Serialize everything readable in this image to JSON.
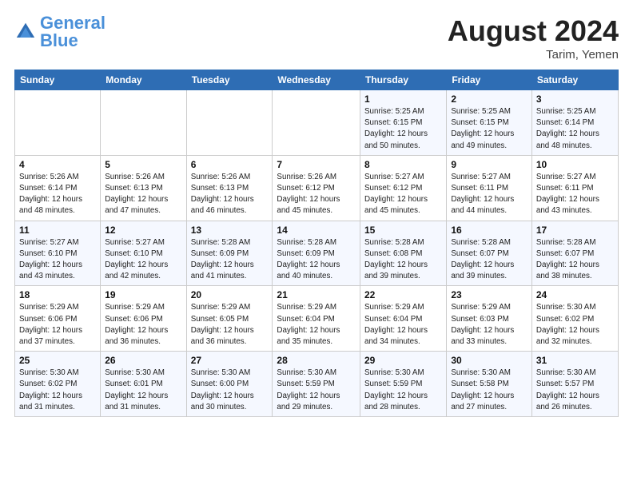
{
  "header": {
    "logo_line1": "General",
    "logo_line2": "Blue",
    "month_title": "August 2024",
    "location": "Tarim, Yemen"
  },
  "weekdays": [
    "Sunday",
    "Monday",
    "Tuesday",
    "Wednesday",
    "Thursday",
    "Friday",
    "Saturday"
  ],
  "weeks": [
    [
      {
        "day": "",
        "info": ""
      },
      {
        "day": "",
        "info": ""
      },
      {
        "day": "",
        "info": ""
      },
      {
        "day": "",
        "info": ""
      },
      {
        "day": "1",
        "info": "Sunrise: 5:25 AM\nSunset: 6:15 PM\nDaylight: 12 hours\nand 50 minutes."
      },
      {
        "day": "2",
        "info": "Sunrise: 5:25 AM\nSunset: 6:15 PM\nDaylight: 12 hours\nand 49 minutes."
      },
      {
        "day": "3",
        "info": "Sunrise: 5:25 AM\nSunset: 6:14 PM\nDaylight: 12 hours\nand 48 minutes."
      }
    ],
    [
      {
        "day": "4",
        "info": "Sunrise: 5:26 AM\nSunset: 6:14 PM\nDaylight: 12 hours\nand 48 minutes."
      },
      {
        "day": "5",
        "info": "Sunrise: 5:26 AM\nSunset: 6:13 PM\nDaylight: 12 hours\nand 47 minutes."
      },
      {
        "day": "6",
        "info": "Sunrise: 5:26 AM\nSunset: 6:13 PM\nDaylight: 12 hours\nand 46 minutes."
      },
      {
        "day": "7",
        "info": "Sunrise: 5:26 AM\nSunset: 6:12 PM\nDaylight: 12 hours\nand 45 minutes."
      },
      {
        "day": "8",
        "info": "Sunrise: 5:27 AM\nSunset: 6:12 PM\nDaylight: 12 hours\nand 45 minutes."
      },
      {
        "day": "9",
        "info": "Sunrise: 5:27 AM\nSunset: 6:11 PM\nDaylight: 12 hours\nand 44 minutes."
      },
      {
        "day": "10",
        "info": "Sunrise: 5:27 AM\nSunset: 6:11 PM\nDaylight: 12 hours\nand 43 minutes."
      }
    ],
    [
      {
        "day": "11",
        "info": "Sunrise: 5:27 AM\nSunset: 6:10 PM\nDaylight: 12 hours\nand 43 minutes."
      },
      {
        "day": "12",
        "info": "Sunrise: 5:27 AM\nSunset: 6:10 PM\nDaylight: 12 hours\nand 42 minutes."
      },
      {
        "day": "13",
        "info": "Sunrise: 5:28 AM\nSunset: 6:09 PM\nDaylight: 12 hours\nand 41 minutes."
      },
      {
        "day": "14",
        "info": "Sunrise: 5:28 AM\nSunset: 6:09 PM\nDaylight: 12 hours\nand 40 minutes."
      },
      {
        "day": "15",
        "info": "Sunrise: 5:28 AM\nSunset: 6:08 PM\nDaylight: 12 hours\nand 39 minutes."
      },
      {
        "day": "16",
        "info": "Sunrise: 5:28 AM\nSunset: 6:07 PM\nDaylight: 12 hours\nand 39 minutes."
      },
      {
        "day": "17",
        "info": "Sunrise: 5:28 AM\nSunset: 6:07 PM\nDaylight: 12 hours\nand 38 minutes."
      }
    ],
    [
      {
        "day": "18",
        "info": "Sunrise: 5:29 AM\nSunset: 6:06 PM\nDaylight: 12 hours\nand 37 minutes."
      },
      {
        "day": "19",
        "info": "Sunrise: 5:29 AM\nSunset: 6:06 PM\nDaylight: 12 hours\nand 36 minutes."
      },
      {
        "day": "20",
        "info": "Sunrise: 5:29 AM\nSunset: 6:05 PM\nDaylight: 12 hours\nand 36 minutes."
      },
      {
        "day": "21",
        "info": "Sunrise: 5:29 AM\nSunset: 6:04 PM\nDaylight: 12 hours\nand 35 minutes."
      },
      {
        "day": "22",
        "info": "Sunrise: 5:29 AM\nSunset: 6:04 PM\nDaylight: 12 hours\nand 34 minutes."
      },
      {
        "day": "23",
        "info": "Sunrise: 5:29 AM\nSunset: 6:03 PM\nDaylight: 12 hours\nand 33 minutes."
      },
      {
        "day": "24",
        "info": "Sunrise: 5:30 AM\nSunset: 6:02 PM\nDaylight: 12 hours\nand 32 minutes."
      }
    ],
    [
      {
        "day": "25",
        "info": "Sunrise: 5:30 AM\nSunset: 6:02 PM\nDaylight: 12 hours\nand 31 minutes."
      },
      {
        "day": "26",
        "info": "Sunrise: 5:30 AM\nSunset: 6:01 PM\nDaylight: 12 hours\nand 31 minutes."
      },
      {
        "day": "27",
        "info": "Sunrise: 5:30 AM\nSunset: 6:00 PM\nDaylight: 12 hours\nand 30 minutes."
      },
      {
        "day": "28",
        "info": "Sunrise: 5:30 AM\nSunset: 5:59 PM\nDaylight: 12 hours\nand 29 minutes."
      },
      {
        "day": "29",
        "info": "Sunrise: 5:30 AM\nSunset: 5:59 PM\nDaylight: 12 hours\nand 28 minutes."
      },
      {
        "day": "30",
        "info": "Sunrise: 5:30 AM\nSunset: 5:58 PM\nDaylight: 12 hours\nand 27 minutes."
      },
      {
        "day": "31",
        "info": "Sunrise: 5:30 AM\nSunset: 5:57 PM\nDaylight: 12 hours\nand 26 minutes."
      }
    ]
  ]
}
